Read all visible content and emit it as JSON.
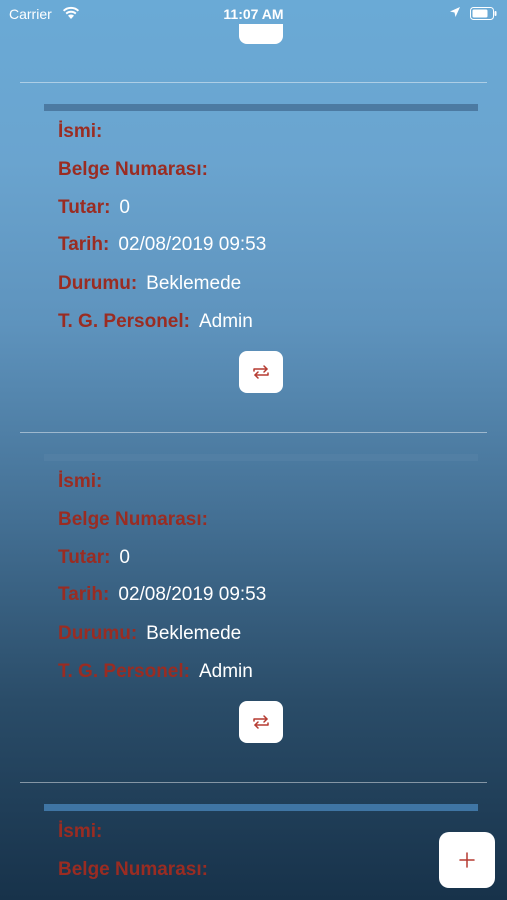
{
  "status_bar": {
    "carrier": "Carrier",
    "time": "11:07 AM"
  },
  "labels": {
    "name": "İsmi:",
    "document_number": "Belge Numarası:",
    "amount": "Tutar:",
    "date": "Tarih:",
    "status": "Durumu:",
    "staff": "T. G. Personel:"
  },
  "records": [
    {
      "name": "",
      "document_number": "",
      "amount": "0",
      "date": "02/08/2019 09:53",
      "status": "Beklemede",
      "staff": "Admin"
    },
    {
      "name": "",
      "document_number": "",
      "amount": "0",
      "date": "02/08/2019 09:53",
      "status": "Beklemede",
      "staff": "Admin"
    },
    {
      "name": "",
      "document_number": ""
    }
  ],
  "icons": {
    "swap": "swap-icon",
    "add": "plus-icon"
  },
  "colors": {
    "label": "#9a2c22",
    "icon_red": "#b53a30",
    "value": "#ffffff",
    "card_bar": "#4c7aa2"
  }
}
